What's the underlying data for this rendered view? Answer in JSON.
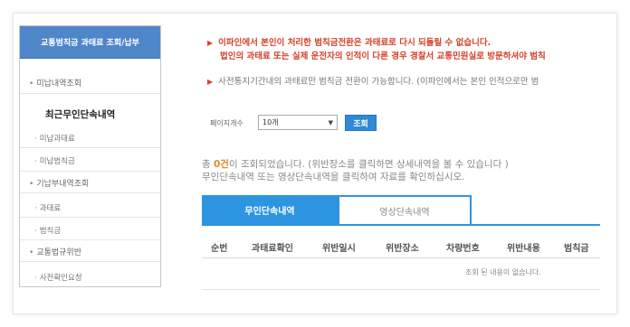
{
  "sidebar": {
    "title": "교통범칙금 과태료 조회/납부",
    "items": [
      {
        "label": "미납내역조회",
        "mark": "•"
      },
      {
        "label": "최근무인단속내역"
      },
      {
        "label": "미납과태료",
        "mark": "·"
      },
      {
        "label": "미납범칙금",
        "mark": "·"
      },
      {
        "label": "기납부내역조회",
        "mark": "•"
      },
      {
        "label": "과태료",
        "mark": "·"
      },
      {
        "label": "범칙금",
        "mark": "·"
      },
      {
        "label": "교통법규위반",
        "mark": "•"
      },
      {
        "label": "사전확인요청",
        "mark": "·"
      }
    ]
  },
  "notices": {
    "arrow": "▶",
    "line1": "이파인에서 본인이 처리한 범칙금전환은 과태료로 다시 되돌릴 수 없습니다.",
    "line2": "법인의 과태료 또는 실제 운전자의 인적이 다른 경우 경찰서 교통민원실로 방문하셔야 범칙",
    "line3": "사전통지기간내의 과태료만 범칙금 전환이 가능합니다. (이파인에서는 본인 인적으로만 범"
  },
  "filter": {
    "page_size_label": "페이지개수",
    "page_size_value": "10개",
    "dropdown_glyph": "▼",
    "search_label": "조회"
  },
  "result": {
    "prefix": "총 ",
    "count": "0건",
    "suffix": "이 조회되었습니다. (위반장소를 클릭하면 상세내역을 볼 수 있습니다 )",
    "line2": "무인단속내역 또는 영상단속내역을 클릭하여 자료를 확인하십시오."
  },
  "tabs": {
    "active": "무인단속내역",
    "inactive": "영상단속내역"
  },
  "table": {
    "headers": [
      "순번",
      "과태료확인",
      "위반일시",
      "위반장소",
      "차량번호",
      "위반내용",
      "범칙금"
    ],
    "empty_message": "조회 된 내용이 없습니다."
  }
}
